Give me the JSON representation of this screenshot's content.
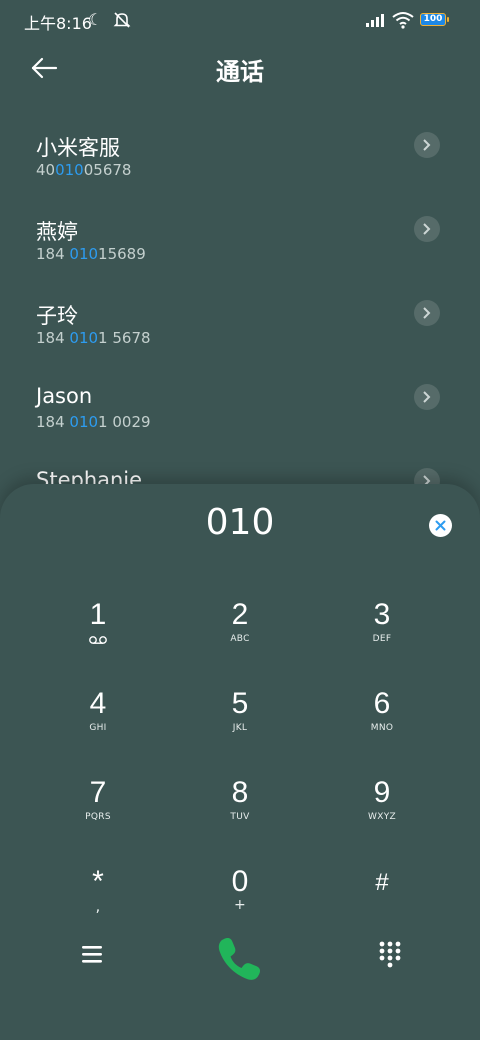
{
  "status": {
    "time": "上午8:16",
    "battery": "100"
  },
  "header": {
    "title": "通话"
  },
  "contacts": [
    {
      "name": "小米客服",
      "num_pre": "40",
      "num_hl": "010",
      "num_post": "05678"
    },
    {
      "name": "燕婷",
      "num_pre": "184 ",
      "num_hl": "010",
      "num_post": "15689"
    },
    {
      "name": "子玲",
      "num_pre": "184 ",
      "num_hl": "010",
      "num_post": "1 5678"
    },
    {
      "name": "Jason",
      "num_pre": "184 ",
      "num_hl": "010",
      "num_post": "1 0029"
    },
    {
      "name": "Stephanie",
      "num_pre": "",
      "num_hl": "",
      "num_post": ""
    }
  ],
  "dialer": {
    "input": "010",
    "keys": [
      {
        "digit": "1",
        "letters": ""
      },
      {
        "digit": "2",
        "letters": "ABC"
      },
      {
        "digit": "3",
        "letters": "DEF"
      },
      {
        "digit": "4",
        "letters": "GHI"
      },
      {
        "digit": "5",
        "letters": "JKL"
      },
      {
        "digit": "6",
        "letters": "MNO"
      },
      {
        "digit": "7",
        "letters": "PQRS"
      },
      {
        "digit": "8",
        "letters": "TUV"
      },
      {
        "digit": "9",
        "letters": "WXYZ"
      },
      {
        "digit": "*",
        "letters": ","
      },
      {
        "digit": "0",
        "letters": "+"
      },
      {
        "digit": "#",
        "letters": ""
      }
    ]
  },
  "icons": {
    "back": "arrow-left-icon",
    "call": "phone-icon",
    "menu": "menu-icon",
    "keypad": "dialpad-grid-icon",
    "voicemail": "voicemail-icon",
    "clear": "close-circle-icon"
  },
  "colors": {
    "background": "#3c5553",
    "highlight": "#2d9cf0",
    "call": "#21b55a"
  }
}
